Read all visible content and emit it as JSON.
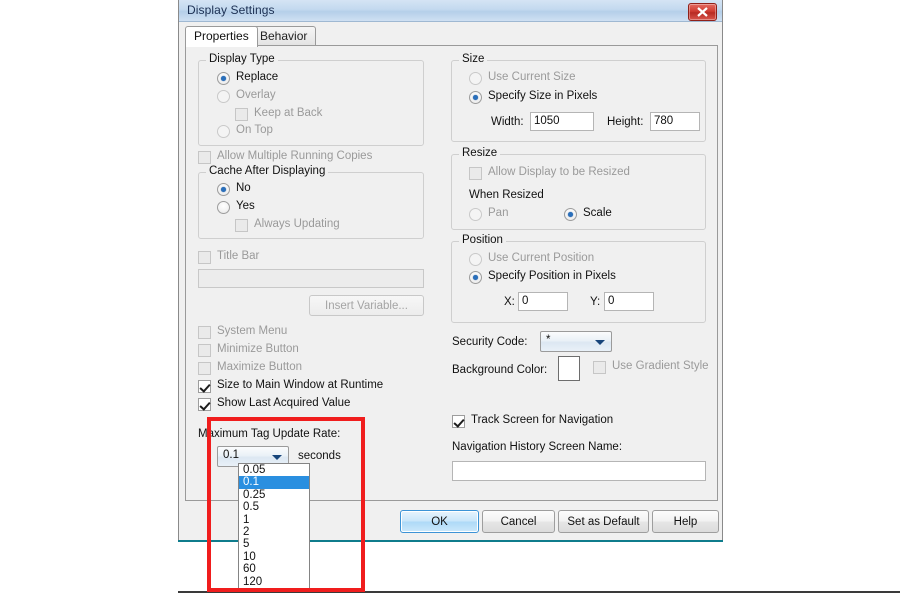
{
  "window": {
    "title": "Display Settings",
    "close_label": "Close"
  },
  "tabs": [
    {
      "label": "Properties",
      "active": true
    },
    {
      "label": "Behavior",
      "active": false
    }
  ],
  "left_column": {
    "display_type": {
      "title": "Display Type",
      "options": [
        {
          "label": "Replace",
          "selected": true,
          "enabled": true
        },
        {
          "label": "Overlay",
          "selected": false,
          "enabled": false
        },
        {
          "label": "On Top",
          "selected": false,
          "enabled": false
        }
      ],
      "keep_at_back": {
        "label": "Keep at Back",
        "checked": false,
        "enabled": false
      }
    },
    "allow_multiple_running_copies": {
      "label": "Allow Multiple Running Copies",
      "checked": false,
      "enabled": false
    },
    "cache_after_displaying": {
      "title": "Cache After Displaying",
      "options": [
        {
          "label": "No",
          "selected": true,
          "enabled": true
        },
        {
          "label": "Yes",
          "selected": false,
          "enabled": true
        }
      ],
      "always_updating": {
        "label": "Always Updating",
        "checked": false,
        "enabled": false
      }
    },
    "title_bar": {
      "label": "Title Bar",
      "checked": false,
      "enabled": false
    },
    "title_bar_text": {
      "value": "",
      "enabled": false
    },
    "insert_variable_button": {
      "label": "Insert Variable...",
      "enabled": false
    },
    "window_options": [
      {
        "label": "System Menu",
        "checked": false,
        "enabled": false
      },
      {
        "label": "Minimize Button",
        "checked": false,
        "enabled": false
      },
      {
        "label": "Maximize Button",
        "checked": false,
        "enabled": false
      },
      {
        "label": "Size to Main Window at Runtime",
        "checked": true,
        "enabled": true
      },
      {
        "label": "Show Last Acquired Value",
        "checked": true,
        "enabled": true
      }
    ],
    "max_tag_update_rate": {
      "label": "Maximum Tag Update Rate:",
      "selected_value": "0.1",
      "units_label": "seconds",
      "expanded": true,
      "options": [
        "0.05",
        "0.1",
        "0.25",
        "0.5",
        "1",
        "2",
        "5",
        "10",
        "60",
        "120"
      ]
    }
  },
  "right_column": {
    "size": {
      "title": "Size",
      "options": [
        {
          "label": "Use Current Size",
          "selected": false,
          "enabled": false
        },
        {
          "label": "Specify Size in Pixels",
          "selected": true,
          "enabled": true
        }
      ],
      "width": {
        "label": "Width:",
        "value": "1050"
      },
      "height": {
        "label": "Height:",
        "value": "780"
      }
    },
    "resize": {
      "title": "Resize",
      "allow_resize": {
        "label": "Allow Display to be Resized",
        "checked": false,
        "enabled": false
      },
      "when_resized_label": "When Resized",
      "options": [
        {
          "label": "Pan",
          "selected": false,
          "enabled": false
        },
        {
          "label": "Scale",
          "selected": true,
          "enabled": true
        }
      ]
    },
    "position": {
      "title": "Position",
      "options": [
        {
          "label": "Use Current Position",
          "selected": false,
          "enabled": false
        },
        {
          "label": "Specify Position in Pixels",
          "selected": true,
          "enabled": true
        }
      ],
      "x": {
        "label": "X:",
        "value": "0"
      },
      "y": {
        "label": "Y:",
        "value": "0"
      }
    },
    "security_code": {
      "label": "Security Code:",
      "value": "*"
    },
    "background_color": {
      "label": "Background Color:",
      "swatch_hex": "#ffffff"
    },
    "use_gradient_style": {
      "label": "Use Gradient Style",
      "checked": false,
      "enabled": false
    },
    "track_screen_for_navigation": {
      "label": "Track Screen for Navigation",
      "checked": true,
      "enabled": true
    },
    "navigation_history_screen_name": {
      "label": "Navigation History Screen Name:",
      "value": ""
    }
  },
  "footer_buttons": [
    {
      "label": "OK",
      "default": true
    },
    {
      "label": "Cancel",
      "default": false
    },
    {
      "label": "Set as Default",
      "default": false
    },
    {
      "label": "Help",
      "default": false
    }
  ],
  "annotation": {
    "highlight_color": "#f01d1d",
    "highlight_target": "max-tag-update-rate"
  }
}
